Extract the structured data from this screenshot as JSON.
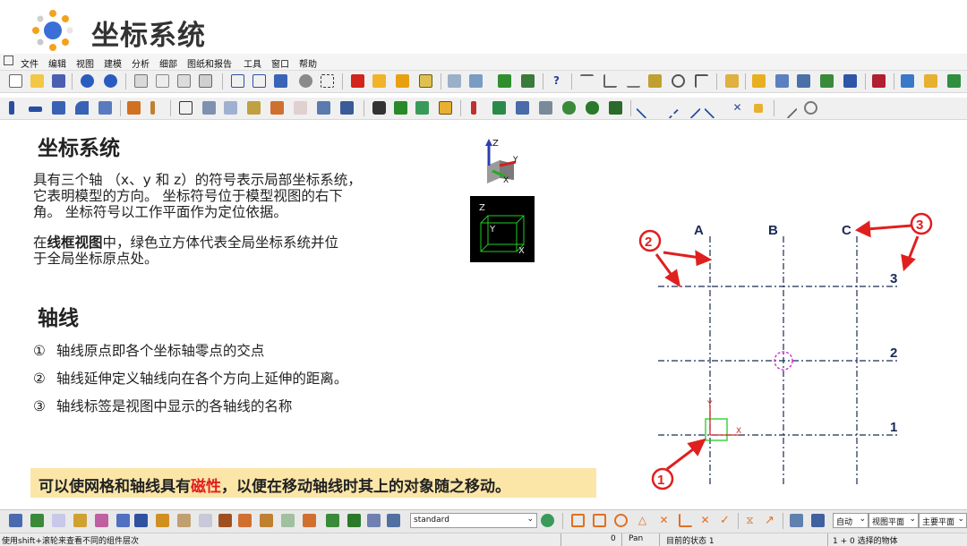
{
  "header": {
    "title": "坐标系统"
  },
  "menu": [
    "文件",
    "编辑",
    "视图",
    "建模",
    "分析",
    "细部",
    "图纸和报告",
    "工具",
    "窗口",
    "帮助"
  ],
  "section1": {
    "heading": "坐标系统",
    "para1_lines": [
      "具有三个轴 （x、y 和 z）的符号表示局部坐标系统，",
      "它表明模型的方向。 坐标符号位于模型视图的右下",
      "角。 坐标符号以工作平面作为定位依据。"
    ],
    "para2_prefix": "在",
    "para2_bold": "线框视图",
    "para2_rest1": "中，绿色立方体代表全局坐标系统并位",
    "para2_line2": "于全局坐标原点处。"
  },
  "section2": {
    "heading": "轴线",
    "items": [
      {
        "num": "①",
        "text": "轴线原点即各个坐标轴零点的交点"
      },
      {
        "num": "②",
        "text": "轴线延伸定义轴线向在各个方向上延伸的距离。"
      },
      {
        "num": "③",
        "text": "轴线标签是视图中显示的各轴线的名称"
      }
    ]
  },
  "highlight": {
    "prefix": "可以使网格和轴线具有",
    "emph": "磁性",
    "suffix": "，以便在移动轴线时其上的对象随之移动。"
  },
  "coord_icon": {
    "z": "Z",
    "y": "Y",
    "x": "X"
  },
  "cube_icon": {
    "z": "Z",
    "y": "Y",
    "x": "X"
  },
  "grid": {
    "col_labels": [
      "A",
      "B",
      "C"
    ],
    "row_labels": [
      "3",
      "2",
      "1"
    ],
    "callouts": [
      "1",
      "2",
      "3"
    ],
    "origin_axes": {
      "y": "Y",
      "x": "X"
    }
  },
  "bottom_toolbar": {
    "standard_select": "standard",
    "auto_select": "自动",
    "view_plane_select": "视图平面",
    "main_plane_select": "主要平面"
  },
  "statusbar": {
    "hint": "使用shift+滚轮来查看不同的组件层次",
    "count": "0",
    "mode": "Pan",
    "state": "目前的状态 1",
    "selection": "1 + 0 选择的物体"
  },
  "colors": {
    "accent_red": "#e01f1f",
    "highlight_bg": "#fbe6a8",
    "grid_line": "#1a2a55",
    "green_axis": "#22cc22"
  }
}
